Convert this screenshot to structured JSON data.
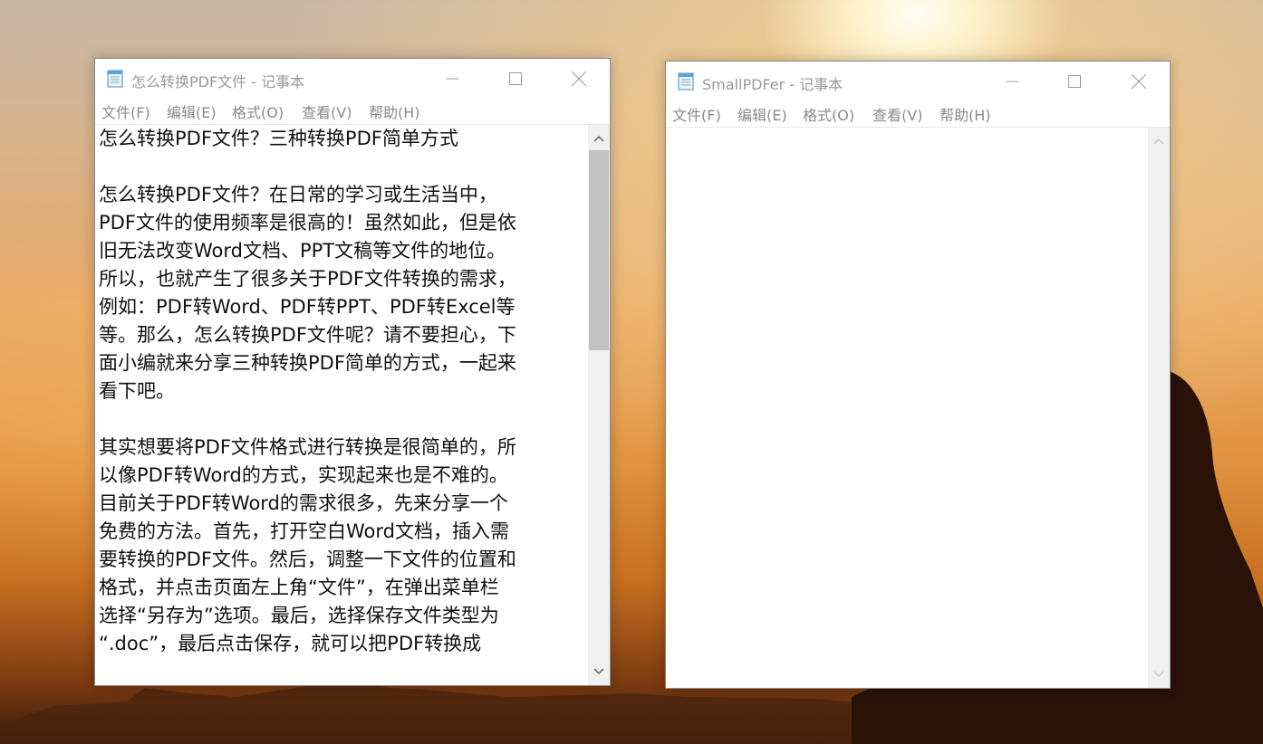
{
  "window_left": {
    "title": "怎么转换PDF文件 - 记事本",
    "menu": [
      "文件(F)",
      "编辑(E)",
      "格式(O)",
      "查看(V)",
      "帮助(H)"
    ],
    "lines": [
      "怎么转换PDF文件？三种转换PDF简单方式",
      "",
      "怎么转换PDF文件？在日常的学习或生活当中，",
      "PDF文件的使用频率是很高的！虽然如此，但是依",
      "旧无法改变Word文档、PPT文稿等文件的地位。",
      "所以，也就产生了很多关于PDF文件转换的需求，",
      "例如：PDF转Word、PDF转PPT、PDF转Excel等",
      "等。那么，怎么转换PDF文件呢？请不要担心，下",
      "面小编就来分享三种转换PDF简单的方式，一起来",
      "看下吧。",
      "",
      "其实想要将PDF文件格式进行转换是很简单的，所",
      "以像PDF转Word的方式，实现起来也是不难的。",
      "目前关于PDF转Word的需求很多，先来分享一个",
      "免费的方法。首先，打开空白Word文档，插入需",
      "要转换的PDF文件。然后，调整一下文件的位置和",
      "格式，并点击页面左上角“文件”，在弹出菜单栏",
      "选择“另存为”选项。最后，选择保存文件类型为",
      "“.doc”，最后点击保存，就可以把PDF转换成"
    ],
    "scroll_position": 0.0,
    "scroll_visible_fraction": 0.4
  },
  "window_right": {
    "title": "SmallPDFer - 记事本",
    "menu": [
      "文件(F)",
      "编辑(E)",
      "格式(O)",
      "查看(V)",
      "帮助(H)"
    ],
    "content": ""
  },
  "icons": [
    "notepad-icon",
    "minimize-icon",
    "maximize-icon",
    "close-icon",
    "scroll-up-arrow-icon",
    "scroll-down-arrow-icon"
  ],
  "colors": {
    "title_inactive": "#9a9a9a",
    "menu_text": "#8a8a8a",
    "text": "#111111",
    "scroll_thumb": "#c2c2c2"
  }
}
